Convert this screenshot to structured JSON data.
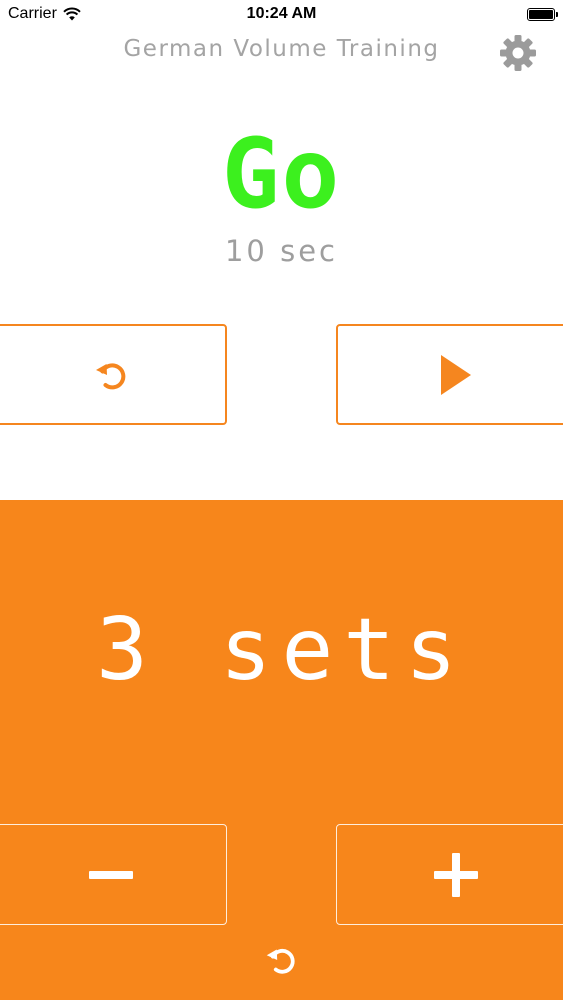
{
  "status_bar": {
    "carrier": "Carrier",
    "time": "10:24 AM"
  },
  "nav": {
    "title": "German Volume Training",
    "settings_icon": "gear-icon"
  },
  "timer": {
    "status": "Go",
    "label": "10 sec",
    "status_color": "#3cf01e"
  },
  "controls": {
    "reset_icon": "undo-icon",
    "play_icon": "play-icon"
  },
  "sets": {
    "label": "3 sets",
    "decrement_icon": "minus-icon",
    "increment_icon": "plus-icon",
    "reset_icon": "undo-icon"
  },
  "colors": {
    "accent": "#f7861b",
    "title_gray": "#a4a4a4"
  }
}
